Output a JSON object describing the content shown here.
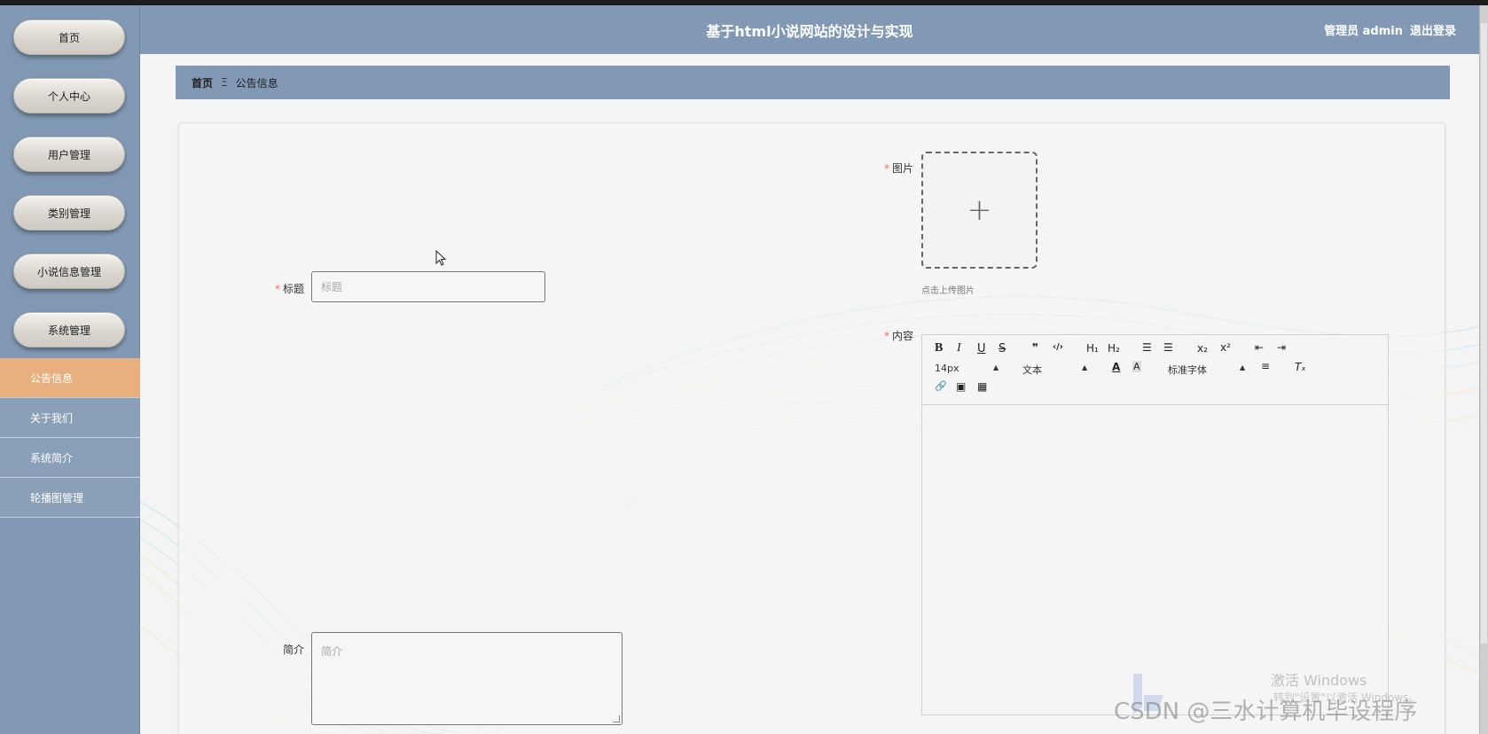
{
  "header": {
    "title": "基于html小说网站的设计与实现",
    "user_label": "管理员 admin",
    "logout_label": "退出登录"
  },
  "sidebar": {
    "main_items": [
      {
        "label": "首页"
      },
      {
        "label": "个人中心"
      },
      {
        "label": "用户管理"
      },
      {
        "label": "类别管理"
      },
      {
        "label": "小说信息管理"
      },
      {
        "label": "系统管理"
      }
    ],
    "sub_items": [
      {
        "label": "公告信息",
        "active": true
      },
      {
        "label": "关于我们"
      },
      {
        "label": "系统简介"
      },
      {
        "label": "轮播图管理"
      }
    ]
  },
  "breadcrumb": {
    "home": "首页",
    "separator": "Ξ",
    "current": "公告信息"
  },
  "form": {
    "title_label": "标题",
    "title_placeholder": "标题",
    "image_label": "图片",
    "upload_hint": "点击上传图片",
    "content_label": "内容",
    "summary_label": "简介",
    "summary_placeholder": "简介",
    "required_mark": "*"
  },
  "editor": {
    "bold": "B",
    "italic": "I",
    "underline": "U",
    "strike": "S",
    "quote": "❞",
    "code": "‹/›",
    "h1": "H₁",
    "h2": "H₂",
    "ordered_list": "☰",
    "bullet_list": "☰",
    "sub": "x₂",
    "sup": "x²",
    "outdent": "⇤",
    "indent": "⇥",
    "font_size": "14px",
    "text_style": "文本",
    "font_family": "标准字体",
    "font_color": "A",
    "bg_color": "A",
    "align": "≡",
    "clear": "Tₓ",
    "link": "🔗",
    "image": "▣",
    "video": "▦"
  },
  "watermarks": {
    "csdn": "CSDN @三水计算机毕设程序",
    "windows_line1": "激活 Windows",
    "windows_line2": "转到\"设置\"以激活 Windows。"
  },
  "colors": {
    "sidebar": "#8199b4",
    "active_item": "#e8b07e",
    "required": "#f56c6c"
  }
}
